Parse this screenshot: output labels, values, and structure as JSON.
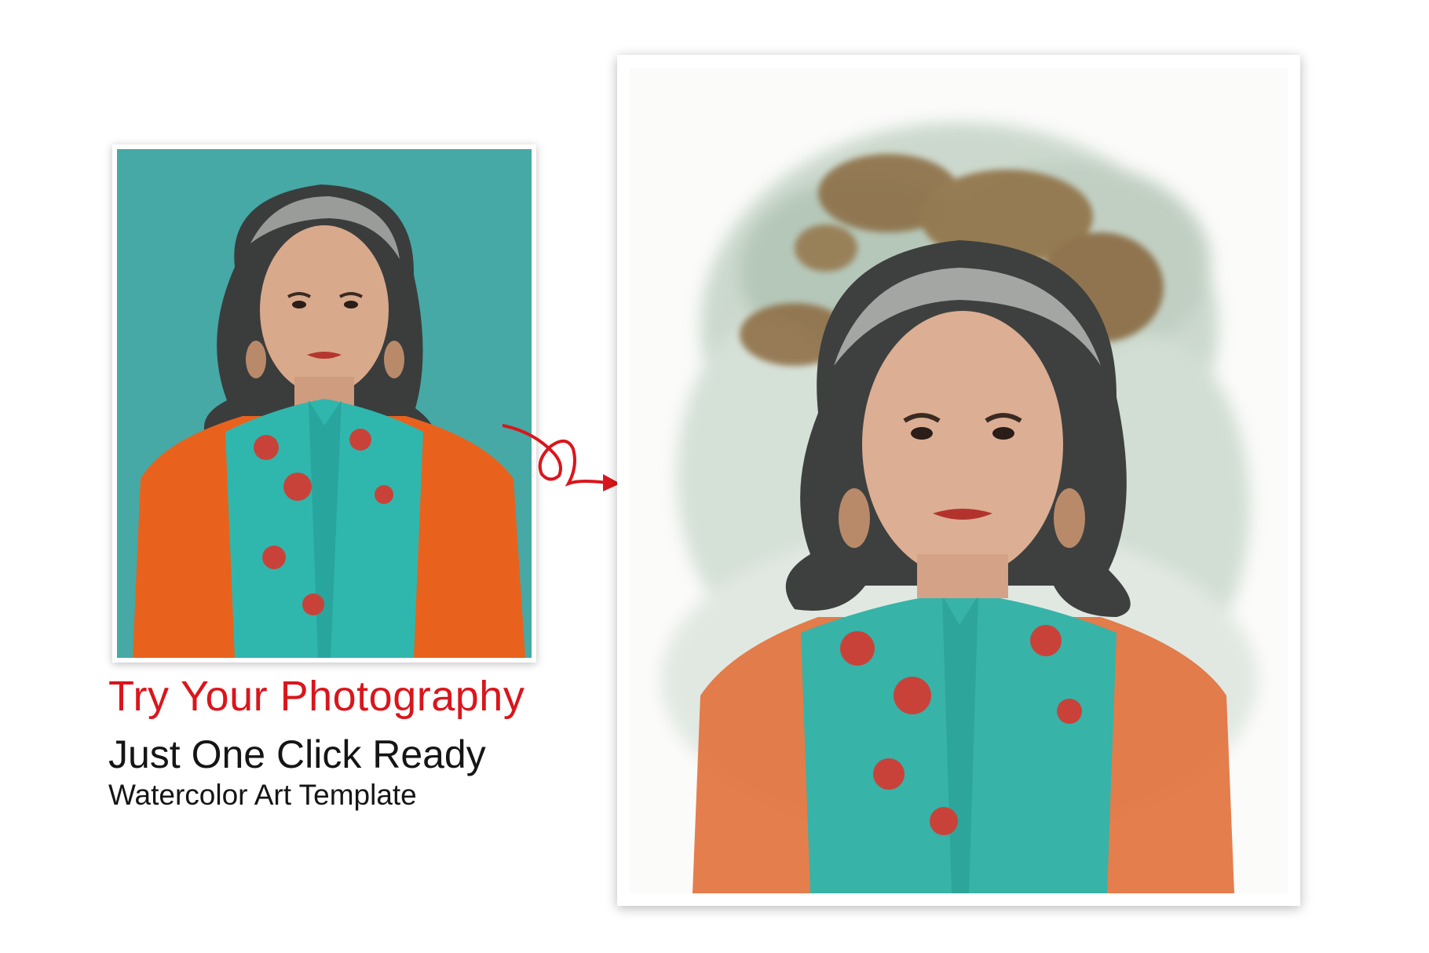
{
  "caption": {
    "headline": "Try Your Photography",
    "subline": "Just One Click Ready",
    "tagline": "Watercolor Art Template"
  },
  "colors": {
    "accent": "#d9161c",
    "text": "#151515",
    "teal_background": "#3fa6a4",
    "orange_jacket": "#e8621e",
    "teal_blouse": "#2fb7ad",
    "floral_red": "#c9423a"
  },
  "icons": {
    "arrow": "curly-arrow-icon"
  }
}
